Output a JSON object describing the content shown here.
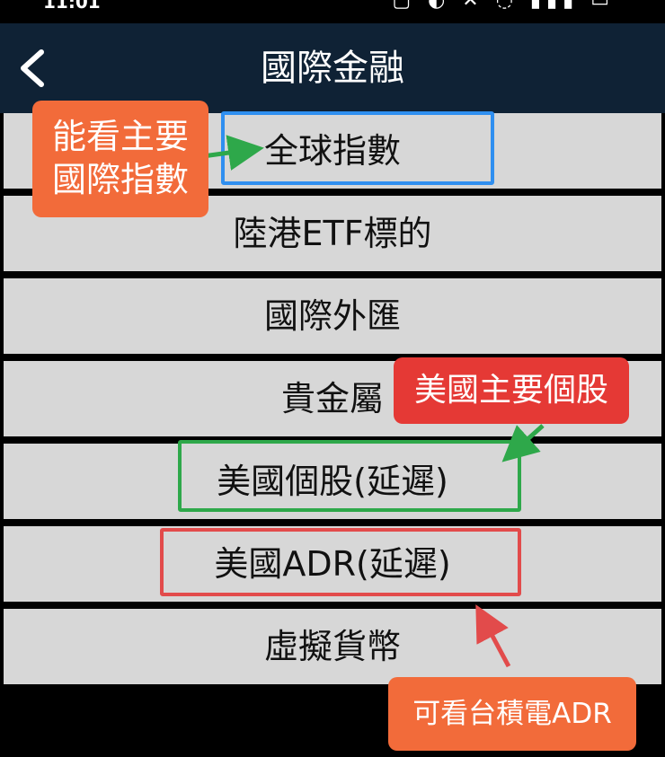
{
  "status": {
    "time": "11:01",
    "carrier_icon": "k-app-icon",
    "indicators": "▢ ◐ ✕ ◌ ▮▮▮ ▭"
  },
  "header": {
    "title": "國際金融",
    "back_icon": "chevron-left-icon"
  },
  "menu": {
    "items": [
      {
        "label": "全球指數"
      },
      {
        "label": "陸港ETF標的"
      },
      {
        "label": "國際外匯"
      },
      {
        "label": "貴金屬"
      },
      {
        "label": "美國個股(延遲)"
      },
      {
        "label": "美國ADR(延遲)"
      },
      {
        "label": "虛擬貨幣"
      }
    ]
  },
  "annotations": {
    "global_index": {
      "line1": "能看主要",
      "line2": "國際指數",
      "color": "#f26b3a",
      "box_color": "#2f8ff0"
    },
    "us_stocks": {
      "text": "美國主要個股",
      "color": "#e53935",
      "box_color": "#2ea84a"
    },
    "adr": {
      "text": "可看台積電ADR",
      "color": "#f26b3a",
      "box_color": "#e24b4b"
    }
  }
}
